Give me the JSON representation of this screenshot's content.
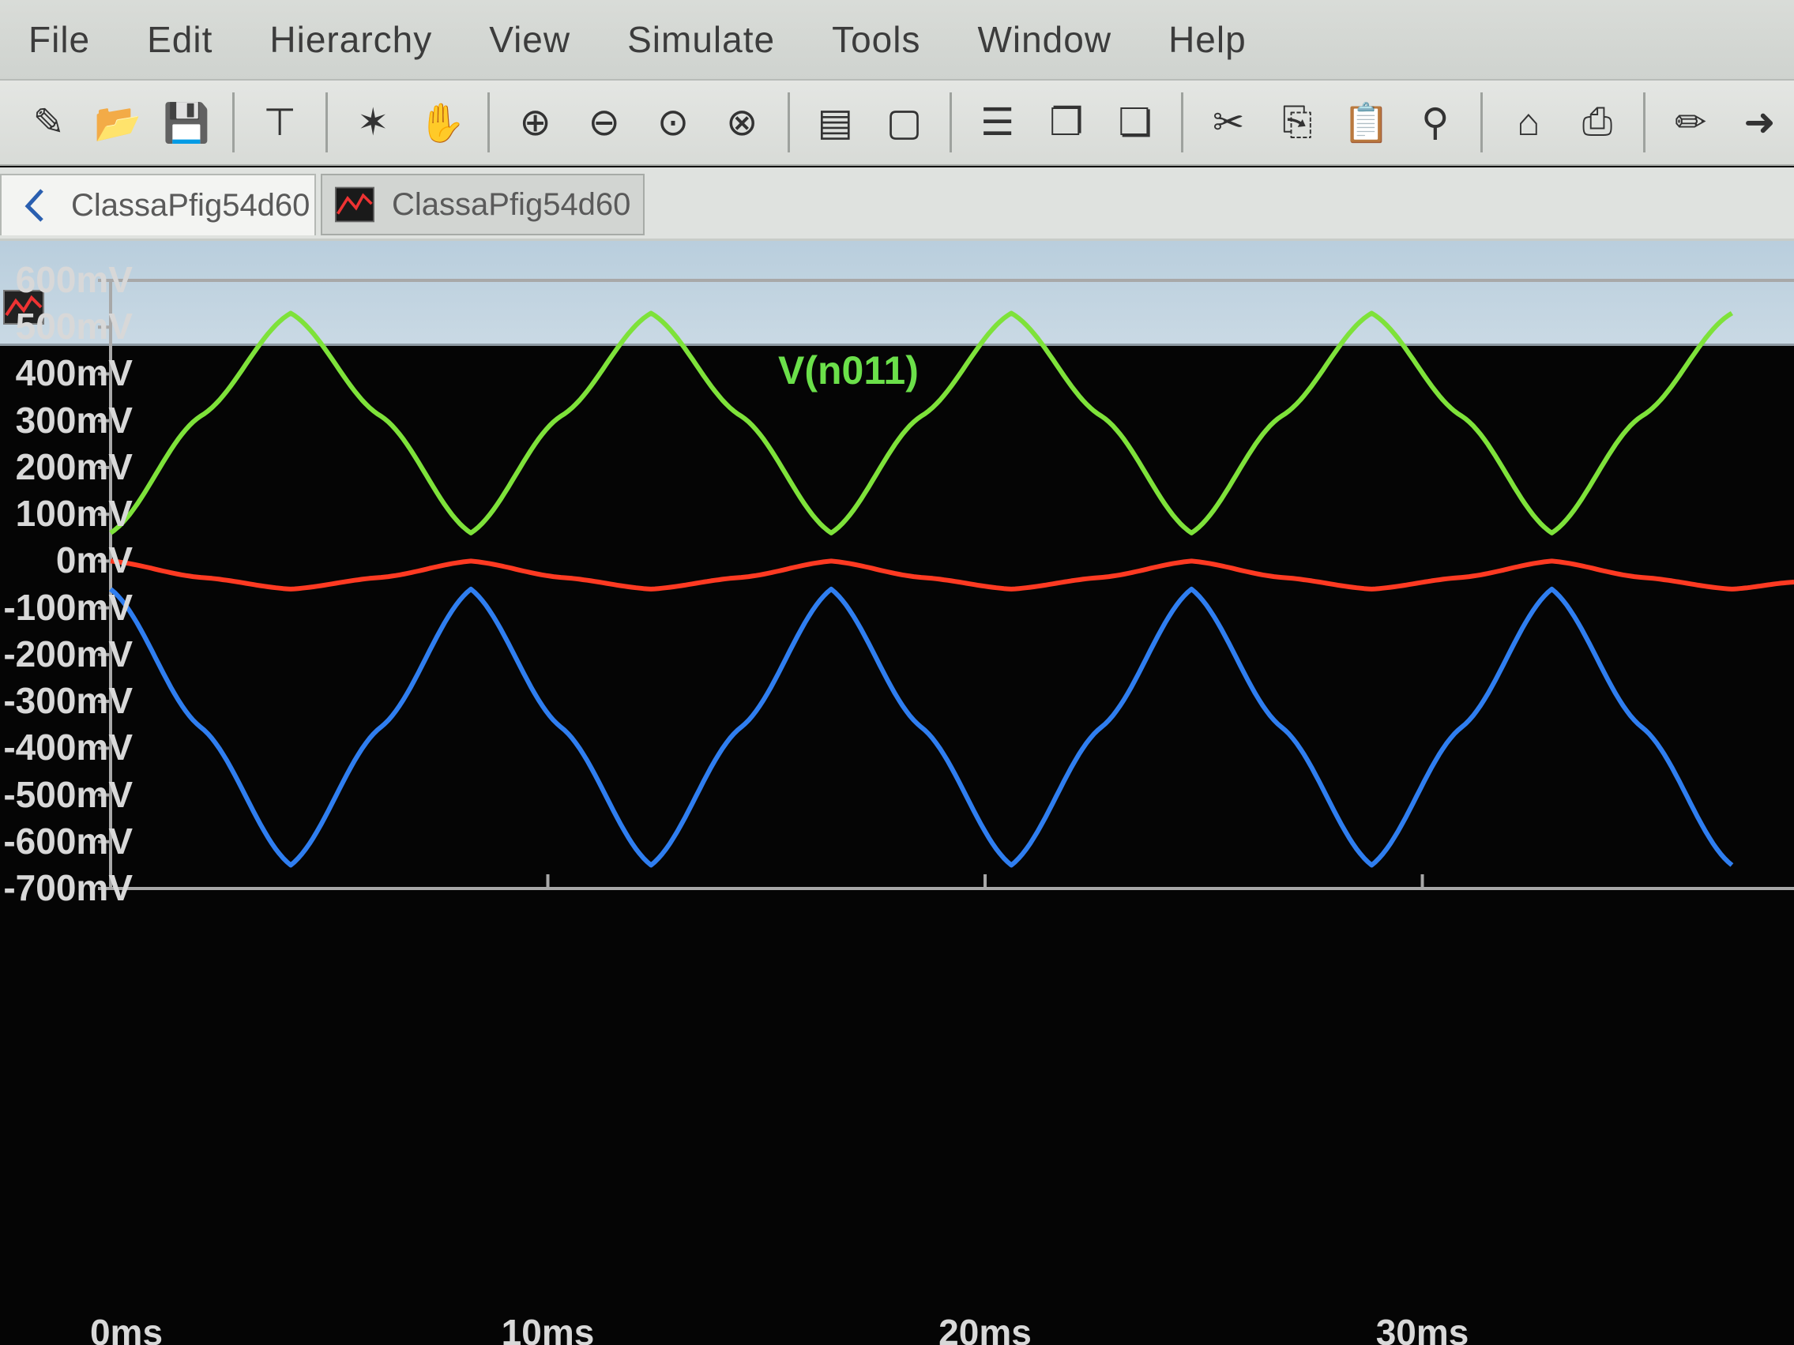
{
  "menu": {
    "items": [
      "File",
      "Edit",
      "Hierarchy",
      "View",
      "Simulate",
      "Tools",
      "Window",
      "Help"
    ]
  },
  "toolbar": {
    "groups": [
      [
        "new-schematic-icon",
        "open-folder-icon",
        "save-icon"
      ],
      [
        "probe-icon"
      ],
      [
        "run-icon",
        "pan-hand-icon"
      ],
      [
        "zoom-in-icon",
        "zoom-out-icon",
        "zoom-full-icon",
        "zoom-cancel-icon"
      ],
      [
        "add-plot-pane-icon",
        "delete-plot-pane-icon"
      ],
      [
        "tile-horizontal-icon",
        "cascade-icon",
        "tile-vertical-icon"
      ],
      [
        "cut-icon",
        "copy-icon",
        "paste-icon",
        "find-icon"
      ],
      [
        "undo-icon",
        "print-icon"
      ],
      [
        "pencil-icon",
        "arrow-icon"
      ]
    ]
  },
  "tabs": [
    {
      "label": "ClassaPfig54d60",
      "kind": "schematic"
    },
    {
      "label": "ClassaPfig54d60",
      "kind": "waveform"
    }
  ],
  "chart_data": {
    "type": "line",
    "title": "V(n011)",
    "xlabel": "",
    "ylabel": "",
    "x_unit": "ms",
    "y_unit": "mV",
    "xlim": [
      0,
      38.5
    ],
    "ylim": [
      -700,
      600
    ],
    "xticks": [
      "0ms",
      "10ms",
      "20ms",
      "30ms"
    ],
    "xtick_values": [
      0,
      10,
      20,
      30
    ],
    "yticks": [
      "600mV",
      "500mV",
      "400mV",
      "300mV",
      "200mV",
      "100mV",
      "0mV",
      "-100mV",
      "-200mV",
      "-300mV",
      "-400mV",
      "-500mV",
      "-600mV",
      "-700mV"
    ],
    "ytick_values": [
      600,
      500,
      400,
      300,
      200,
      100,
      0,
      -100,
      -200,
      -300,
      -400,
      -500,
      -600,
      -700
    ],
    "grid": false,
    "background": "#050505",
    "series": [
      {
        "color": "#7ee23a",
        "x": [
          0,
          2.06,
          4.12,
          6.18,
          8.24,
          10.3,
          12.36,
          14.42,
          16.48,
          18.54,
          20.6,
          22.66,
          24.72,
          26.78,
          28.84,
          30.9,
          32.96,
          35.02,
          37.08
        ],
        "y": [
          60,
          310,
          530,
          310,
          60,
          310,
          530,
          310,
          60,
          310,
          530,
          310,
          60,
          310,
          530,
          310,
          60,
          310,
          530
        ]
      },
      {
        "color": "#ff3a22",
        "x": [
          0,
          2.06,
          4.12,
          6.18,
          8.24,
          10.3,
          12.36,
          14.42,
          16.48,
          18.54,
          20.6,
          22.66,
          24.72,
          26.78,
          28.84,
          30.9,
          32.96,
          35.02,
          37.08,
          38.5
        ],
        "y": [
          0,
          -35,
          -60,
          -35,
          0,
          -35,
          -60,
          -35,
          0,
          -35,
          -60,
          -35,
          0,
          -35,
          -60,
          -35,
          0,
          -35,
          -60,
          -45
        ]
      },
      {
        "color": "#2f7ef0",
        "x": [
          0,
          2.06,
          4.12,
          6.18,
          8.24,
          10.3,
          12.36,
          14.42,
          16.48,
          18.54,
          20.6,
          22.66,
          24.72,
          26.78,
          28.84,
          30.9,
          32.96,
          35.02,
          37.08
        ],
        "y": [
          -60,
          -355,
          -650,
          -355,
          -60,
          -355,
          -650,
          -355,
          -60,
          -355,
          -650,
          -355,
          -60,
          -355,
          -650,
          -355,
          -60,
          -355,
          -650
        ]
      }
    ]
  }
}
